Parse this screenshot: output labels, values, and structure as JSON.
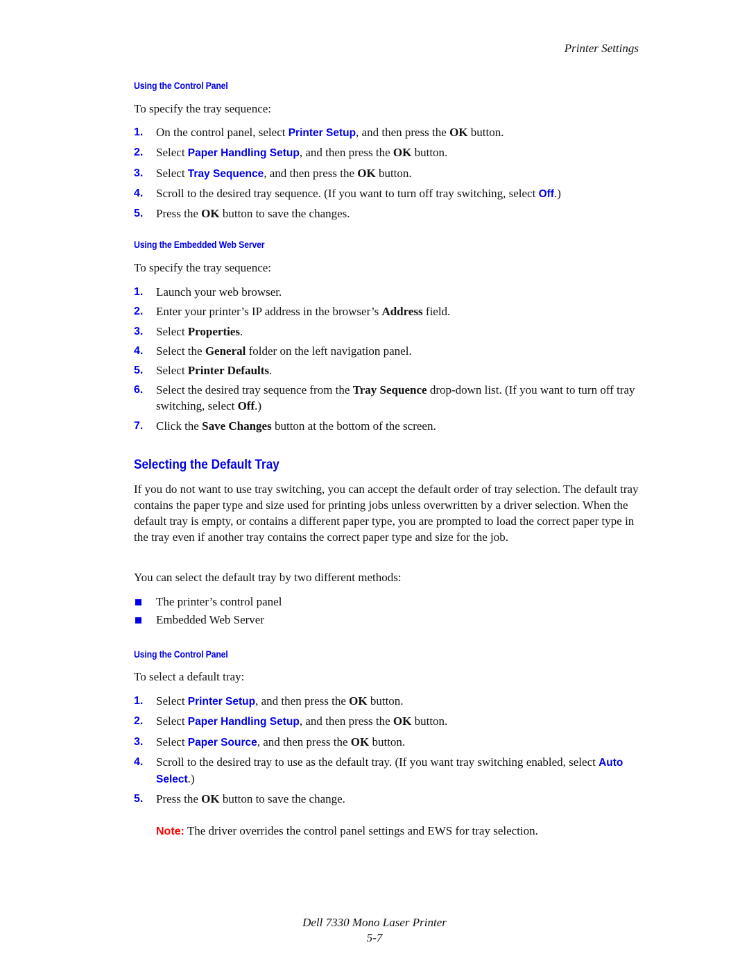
{
  "header": {
    "running_title": "Printer Settings"
  },
  "section1": {
    "subhead": "Using the Control Panel",
    "intro": "To specify the tray sequence:",
    "steps": [
      {
        "num": "1.",
        "parts": [
          {
            "t": "On the control panel, select "
          },
          {
            "ui": "Printer Setup"
          },
          {
            "t": ", and then press the "
          },
          {
            "b": "OK"
          },
          {
            "t": " button."
          }
        ]
      },
      {
        "num": "2.",
        "parts": [
          {
            "t": "Select "
          },
          {
            "ui": "Paper Handling Setup"
          },
          {
            "t": ", and then press the "
          },
          {
            "b": "OK"
          },
          {
            "t": " button."
          }
        ]
      },
      {
        "num": "3.",
        "parts": [
          {
            "t": "Select "
          },
          {
            "ui": "Tray Sequence"
          },
          {
            "t": ", and then press the "
          },
          {
            "b": "OK"
          },
          {
            "t": " button."
          }
        ]
      },
      {
        "num": "4.",
        "parts": [
          {
            "t": "Scroll to the desired tray sequence. (If you want to turn off tray switching, select "
          },
          {
            "ui": "Off"
          },
          {
            "t": ".)"
          }
        ]
      },
      {
        "num": "5.",
        "parts": [
          {
            "t": "Press the "
          },
          {
            "b": "OK"
          },
          {
            "t": " button to save the changes."
          }
        ]
      }
    ]
  },
  "section2": {
    "subhead": "Using the Embedded Web Server",
    "intro": "To specify the tray sequence:",
    "steps": [
      {
        "num": "1.",
        "parts": [
          {
            "t": "Launch your web browser."
          }
        ]
      },
      {
        "num": "2.",
        "parts": [
          {
            "t": "Enter your printer’s IP address in the browser’s "
          },
          {
            "b": "Address"
          },
          {
            "t": " field."
          }
        ]
      },
      {
        "num": "3.",
        "parts": [
          {
            "t": "Select "
          },
          {
            "b": "Properties"
          },
          {
            "t": "."
          }
        ]
      },
      {
        "num": "4.",
        "parts": [
          {
            "t": "Select the "
          },
          {
            "b": "General"
          },
          {
            "t": " folder on the left navigation panel."
          }
        ]
      },
      {
        "num": "5.",
        "parts": [
          {
            "t": "Select "
          },
          {
            "b": "Printer Defaults"
          },
          {
            "t": "."
          }
        ]
      },
      {
        "num": "6.",
        "parts": [
          {
            "t": "Select the desired tray sequence from the "
          },
          {
            "b": "Tray Sequence"
          },
          {
            "t": " drop-down list. (If you want to turn off tray switching, select "
          },
          {
            "b": "Off"
          },
          {
            "t": ".)"
          }
        ]
      },
      {
        "num": "7.",
        "parts": [
          {
            "t": "Click the "
          },
          {
            "b": "Save Changes"
          },
          {
            "t": " button at the bottom of the screen."
          }
        ]
      }
    ]
  },
  "section3": {
    "heading": "Selecting the Default Tray",
    "paragraph": "If you do not want to use tray switching, you can accept the default order of tray selection. The default tray contains the paper type and size used for printing jobs unless overwritten by a driver selection. When the default tray is empty, or contains a different paper type, you are prompted to load the correct paper type in the tray even if another tray contains the correct paper type and size for the job.",
    "methods_intro": "You can select the default tray by two different methods:",
    "methods": [
      "The printer’s control panel",
      "Embedded Web Server"
    ],
    "subhead": "Using the Control Panel",
    "intro": "To select a default tray:",
    "steps": [
      {
        "num": "1.",
        "parts": [
          {
            "t": "Select "
          },
          {
            "ui": "Printer Setup"
          },
          {
            "t": ", and then press the "
          },
          {
            "b": "OK"
          },
          {
            "t": " button."
          }
        ]
      },
      {
        "num": "2.",
        "parts": [
          {
            "t": "Select "
          },
          {
            "ui": "Paper Handling Setup"
          },
          {
            "t": ", and then press the "
          },
          {
            "b": "OK"
          },
          {
            "t": " button."
          }
        ]
      },
      {
        "num": "3.",
        "parts": [
          {
            "t": "Select "
          },
          {
            "ui": "Paper Source"
          },
          {
            "t": ", and then press the "
          },
          {
            "b": "OK"
          },
          {
            "t": " button."
          }
        ]
      },
      {
        "num": "4.",
        "parts": [
          {
            "t": "Scroll to the desired tray to use as the default tray. (If you want tray switching enabled, select "
          },
          {
            "ui": "Auto Select"
          },
          {
            "t": ".)"
          }
        ]
      },
      {
        "num": "5.",
        "parts": [
          {
            "t": "Press the "
          },
          {
            "b": "OK"
          },
          {
            "t": " button to save the change."
          }
        ]
      }
    ],
    "note_label": "Note:",
    "note_text": " The driver overrides the control panel settings and EWS for tray selection."
  },
  "footer": {
    "product": "Dell 7330 Mono Laser Printer",
    "page_number": "5-7"
  },
  "colors": {
    "accent_blue": "#0000e6",
    "note_red": "#ff0000",
    "text": "#111111"
  }
}
